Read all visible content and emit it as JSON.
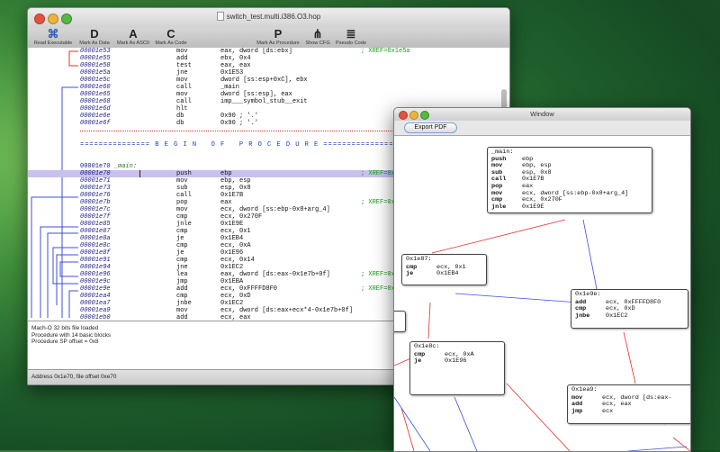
{
  "main_window": {
    "title": "switch_test.multi.i386.O3.hop",
    "toolbar": [
      {
        "icon": "⌘",
        "label": "Read Executable"
      },
      {
        "icon": "D",
        "label": "Mark As Data"
      },
      {
        "icon": "A",
        "label": "Mark As ASCII"
      },
      {
        "icon": "C",
        "label": "Mark As Code"
      },
      {
        "icon": "P",
        "label": "Mark As Procedure"
      },
      {
        "icon": "⋔",
        "label": "Show CFG"
      },
      {
        "icon": "≣",
        "label": "Pseudo Code"
      }
    ],
    "listing": [
      {
        "addr": "00001e53",
        "op": "mov",
        "arg": "eax, dword [ds:ebx]",
        "cmt": "; XREF=0x1e5a"
      },
      {
        "addr": "00001e55",
        "op": "add",
        "arg": "ebx, 0x4",
        "cmt": ""
      },
      {
        "addr": "00001e58",
        "op": "test",
        "arg": "eax, eax",
        "cmt": ""
      },
      {
        "addr": "00001e5a",
        "op": "jne",
        "arg": "0x1E53",
        "cmt": ""
      },
      {
        "addr": "00001e5c",
        "op": "mov",
        "arg": "dword [ss:esp+0xC], ebx",
        "cmt": ""
      },
      {
        "addr": "00001e60",
        "op": "call",
        "arg": "_main",
        "cmt": ""
      },
      {
        "addr": "00001e65",
        "op": "mov",
        "arg": "dword [ss:esp], eax",
        "cmt": ""
      },
      {
        "addr": "00001e68",
        "op": "call",
        "arg": "imp___symbol_stub__exit",
        "cmt": ""
      },
      {
        "addr": "00001e6d",
        "op": "hlt",
        "arg": "",
        "cmt": ""
      },
      {
        "addr": "00001e6e",
        "op": "db",
        "arg": "0x90 ; '.'",
        "cmt": ""
      },
      {
        "addr": "00001e6f",
        "op": "db",
        "arg": "0x90 ; '.'",
        "cmt": ""
      },
      {
        "type": "sep"
      },
      {
        "type": "blank"
      },
      {
        "type": "proc",
        "text": "=============== B E G I N   O F   P R O C E D U R E ==============="
      },
      {
        "type": "blank"
      },
      {
        "type": "blank"
      },
      {
        "type": "label",
        "addr": "00001e70",
        "name": "_main:"
      },
      {
        "addr": "00001e70",
        "op": "push",
        "arg": "ebp",
        "cmt": "; XREF=0x1e60",
        "sel": true
      },
      {
        "addr": "00001e71",
        "op": "mov",
        "arg": "ebp, esp",
        "cmt": ""
      },
      {
        "addr": "00001e73",
        "op": "sub",
        "arg": "esp, 0x8",
        "cmt": ""
      },
      {
        "addr": "00001e76",
        "op": "call",
        "arg": "0x1E7B",
        "cmt": ""
      },
      {
        "addr": "00001e7b",
        "op": "pop",
        "arg": "eax",
        "cmt": "; XREF=0x1e76"
      },
      {
        "addr": "00001e7c",
        "op": "mov",
        "arg": "ecx, dword [ss:ebp-0x8+arg_4]",
        "cmt": ""
      },
      {
        "addr": "00001e7f",
        "op": "cmp",
        "arg": "ecx, 0x270F",
        "cmt": ""
      },
      {
        "addr": "00001e85",
        "op": "jnle",
        "arg": "0x1E9E",
        "cmt": ""
      },
      {
        "addr": "00001e87",
        "op": "cmp",
        "arg": "ecx, 0x1",
        "cmt": ""
      },
      {
        "addr": "00001e8a",
        "op": "je",
        "arg": "0x1EB4",
        "cmt": ""
      },
      {
        "addr": "00001e8c",
        "op": "cmp",
        "arg": "ecx, 0xA",
        "cmt": ""
      },
      {
        "addr": "00001e8f",
        "op": "je",
        "arg": "0x1E96",
        "cmt": ""
      },
      {
        "addr": "00001e91",
        "op": "cmp",
        "arg": "ecx, 0x14",
        "cmt": ""
      },
      {
        "addr": "00001e94",
        "op": "jne",
        "arg": "0x1EC2",
        "cmt": ""
      },
      {
        "addr": "00001e96",
        "op": "lea",
        "arg": "eax, dword [ds:eax-0x1e7b+0f]",
        "cmt": "; XREF=0x1e8f"
      },
      {
        "addr": "00001e9c",
        "op": "jmp",
        "arg": "0x1EBA",
        "cmt": ""
      },
      {
        "addr": "00001e9e",
        "op": "add",
        "arg": "ecx, 0xFFFFD8F0",
        "cmt": "; XREF=0x1e85"
      },
      {
        "addr": "00001ea4",
        "op": "cmp",
        "arg": "ecx, 0xD",
        "cmt": ""
      },
      {
        "addr": "00001ea7",
        "op": "jnbe",
        "arg": "0x1EC2",
        "cmt": ""
      },
      {
        "addr": "00001ea9",
        "op": "mov",
        "arg": "ecx, dword [ds:eax+ecx*4-0x1e7b+0f]",
        "cmt": ""
      },
      {
        "addr": "00001eb0",
        "op": "add",
        "arg": "ecx, eax",
        "cmt": ""
      },
      {
        "addr": "00001eb2",
        "op": "jmp",
        "arg": "ecx",
        "cmt": "; switch"
      }
    ],
    "log": [
      "Mach-O 32 bits file loaded",
      "Procedure with 14 basic blocks",
      "Procedure SP offset = 0x8"
    ],
    "status": "Address 0x1e70, file offset 0xe70"
  },
  "cfg_window": {
    "title": "Window",
    "export_label": "Export PDF",
    "nodes": {
      "main": [
        "_main:",
        [
          "push",
          "ebp"
        ],
        [
          "mov",
          "ebp, esp"
        ],
        [
          "sub",
          "esp, 0x8"
        ],
        [
          "call",
          "0x1E7B"
        ],
        [
          "pop",
          "eax"
        ],
        [
          "mov",
          "ecx, dword [ss:ebp-0x8+arg_4]"
        ],
        [
          "cmp",
          "ecx, 0x270F"
        ],
        [
          "jnle",
          "0x1E9E"
        ]
      ],
      "n1e87": [
        "0x1e87:",
        [
          "cmp",
          "ecx, 0x1"
        ],
        [
          "je",
          "0x1EB4"
        ]
      ],
      "n1e9e": [
        "0x1e9e:",
        [
          "add",
          "ecx, 0xFFFFD8F0"
        ],
        [
          "cmp",
          "ecx, 0xD"
        ],
        [
          "jnbe",
          "0x1EC2"
        ]
      ],
      "n1e8c": [
        "0x1e8c:",
        [
          "cmp",
          "ecx, 0xA"
        ],
        [
          "je",
          "0x1E96"
        ]
      ],
      "n1ea9": [
        "0x1ea9:",
        [
          "mov",
          "ecx, dword [ds:eax-"
        ],
        [
          "add",
          "ecx, eax"
        ],
        [
          "jmp",
          "ecx"
        ]
      ],
      "nleft": [
        "",
        [
          "",
          ""
        ]
      ]
    },
    "colors": {
      "true_edge": "#3c4fd8",
      "false_edge": "#e0302a"
    }
  }
}
